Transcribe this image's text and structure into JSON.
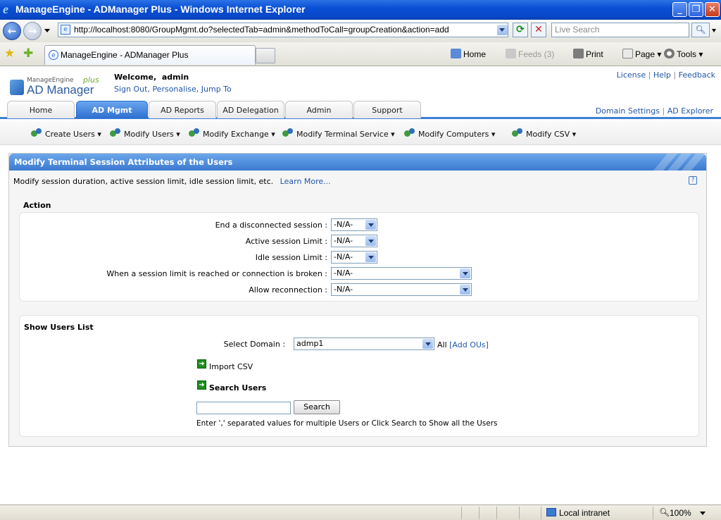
{
  "browser": {
    "title": "ManageEngine - ADManager Plus - Windows Internet Explorer",
    "address": "http://localhost:8080/GroupMgmt.do?selectedTab=admin&methodToCall=groupCreation&action=add",
    "search_placeholder": "Live Search",
    "tab_title": "ManageEngine - ADManager Plus",
    "commands": {
      "home": "Home",
      "feeds": "Feeds (3)",
      "print": "Print",
      "page": "Page",
      "tools": "Tools"
    },
    "status": {
      "zone": "Local intranet",
      "zoom": "100%"
    }
  },
  "app": {
    "logo_top": "ManageEngine",
    "logo_main": "AD Manager",
    "logo_plus": "plus",
    "welcome_prefix": "Welcome,",
    "user": "admin",
    "user_links": [
      "Sign Out",
      "Personalise",
      "Jump To"
    ],
    "top_links": [
      "License",
      "Help",
      "Feedback"
    ],
    "tabs": [
      "Home",
      "AD Mgmt",
      "AD Reports",
      "AD Delegation",
      "Admin",
      "Support"
    ],
    "right_links": [
      "Domain Settings",
      "AD Explorer"
    ],
    "submenu": [
      "Create Users",
      "Modify Users",
      "Modify Exchange",
      "Modify Terminal Service",
      "Modify Computers",
      "Modify CSV"
    ]
  },
  "panel": {
    "title": "Modify Terminal Session Attributes of the Users",
    "description": "Modify session duration, active session limit, idle session limit, etc.",
    "learn_more": "Learn More...",
    "help_icon": "?",
    "action_heading": "Action",
    "fields": [
      {
        "label": "End a disconnected session :",
        "value": "-N/A-"
      },
      {
        "label": "Active session Limit :",
        "value": "-N/A-"
      },
      {
        "label": "Idle session Limit :",
        "value": "-N/A-"
      },
      {
        "label": "When a session limit is reached or connection is broken :",
        "value": "-N/A-"
      },
      {
        "label": "Allow reconnection :",
        "value": "-N/A-"
      }
    ],
    "users_heading": "Show Users List",
    "domain_label": "Select Domain :",
    "domain_value": "admp1",
    "all_label": "All",
    "add_ous": "[Add OUs]",
    "import_csv": "Import CSV",
    "search_users": "Search Users",
    "search_value": "",
    "search_button": "Search",
    "hint": "Enter ',' separated values for multiple Users or Click Search to Show all the Users"
  }
}
